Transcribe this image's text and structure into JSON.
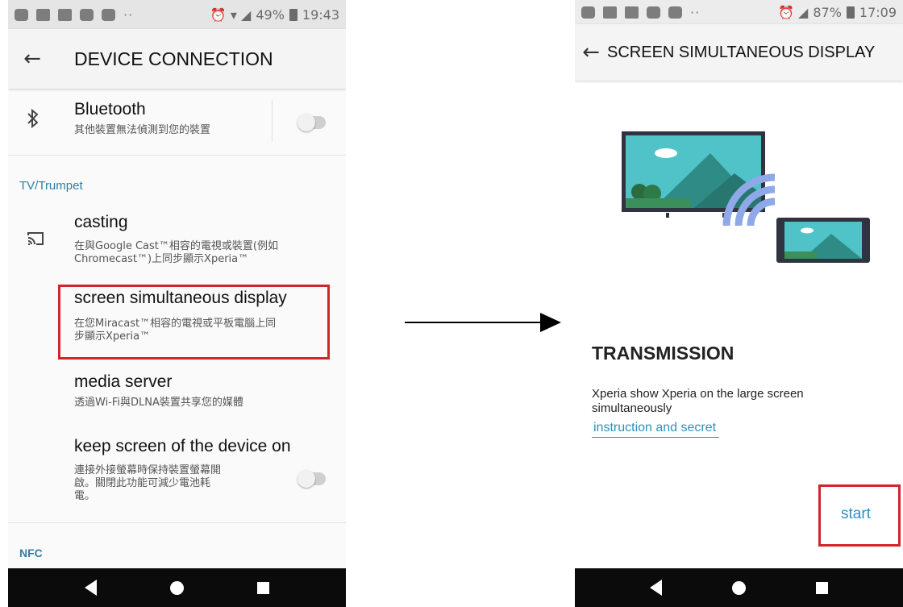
{
  "left_screen": {
    "status_bar": {
      "battery": "49%",
      "time": "19:43"
    },
    "app_bar": {
      "back_icon": "arrow-back-icon",
      "title": "DEVICE CONNECTION"
    },
    "bluetooth": {
      "icon": "bluetooth-icon",
      "title": "Bluetooth",
      "subtitle": "其他裝置無法偵測到您的裝置",
      "toggle": "off"
    },
    "section_tv": "TV/Trumpet",
    "casting": {
      "icon": "cast-icon",
      "title": "casting",
      "subtitle_line1": "在與Google Cast™相容的電視或裝置(例如",
      "subtitle_line2": "Chromecast™)上同步顯示Xperia™"
    },
    "screen_display": {
      "title": "screen  simultaneous display",
      "subtitle_line1": "在您Miracast™相容的電視或平板電腦上同",
      "subtitle_line2": "步顯示Xperia™",
      "highlighted": true
    },
    "media_server": {
      "title": "media server",
      "subtitle": "透過Wi-Fi與DLNA裝置共享您的媒體"
    },
    "keep_screen": {
      "title": "keep screen of the device on",
      "subtitle_line1": "連接外接螢幕時保持裝置螢幕開",
      "subtitle_line2": "啟。關閉此功能可減少電池耗",
      "subtitle_line3": "電。",
      "toggle": "off"
    },
    "section_nfc": "NFC"
  },
  "right_screen": {
    "status_bar": {
      "battery": "87%",
      "time": "17:09"
    },
    "app_bar": {
      "back_icon": "arrow-back-icon",
      "title": "SCREEN  SIMULTANEOUS DISPLAY"
    },
    "illustration": "tv-to-phone-cast-illustration",
    "heading": "TRANSMISSION",
    "description": "Xperia show Xperia on the large screen simultaneously",
    "link": "instruction and secret",
    "start_button": "start"
  },
  "colors": {
    "accent": "#2f8fc0",
    "highlight": "#d0262b",
    "section": "#2f7fa6",
    "navbar": "#0b0b0b"
  }
}
